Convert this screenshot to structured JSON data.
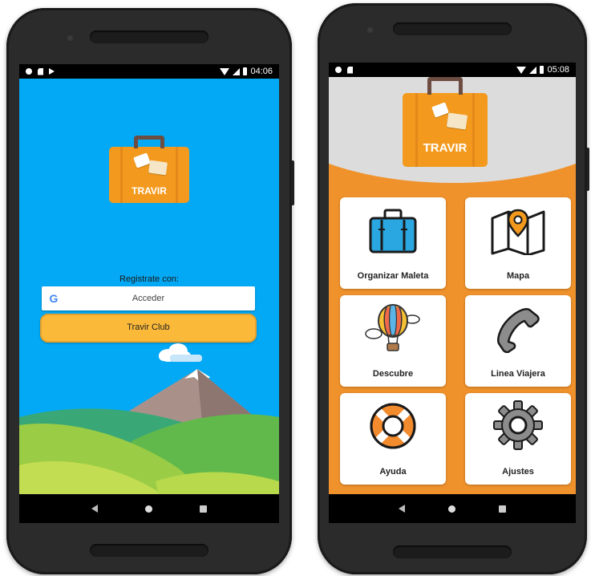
{
  "phone1": {
    "status": {
      "time": "04:06",
      "icons": [
        "circle-icon",
        "sdcard-icon",
        "play-icon"
      ]
    },
    "logo": {
      "brand": "TRAVIR"
    },
    "signup": {
      "label": "Registrate con:",
      "google_label": "Acceder",
      "club_label": "Travir Club"
    }
  },
  "phone2": {
    "status": {
      "time": "05:08"
    },
    "logo": {
      "brand": "TRAVIR"
    },
    "menu": [
      {
        "label": "Organizar Maleta",
        "icon": "suitcase-icon"
      },
      {
        "label": "Mapa",
        "icon": "map-icon"
      },
      {
        "label": "Descubre",
        "icon": "hot-air-balloon-icon"
      },
      {
        "label": "Linea Viajera",
        "icon": "phone-icon"
      },
      {
        "label": "Ayuda",
        "icon": "lifebuoy-icon"
      },
      {
        "label": "Ajustes",
        "icon": "gear-icon"
      }
    ]
  },
  "colors": {
    "sky": "#03a9f4",
    "orange": "#f39a1e",
    "menu_bg": "#f0922c",
    "club_button": "#fbb93a"
  }
}
